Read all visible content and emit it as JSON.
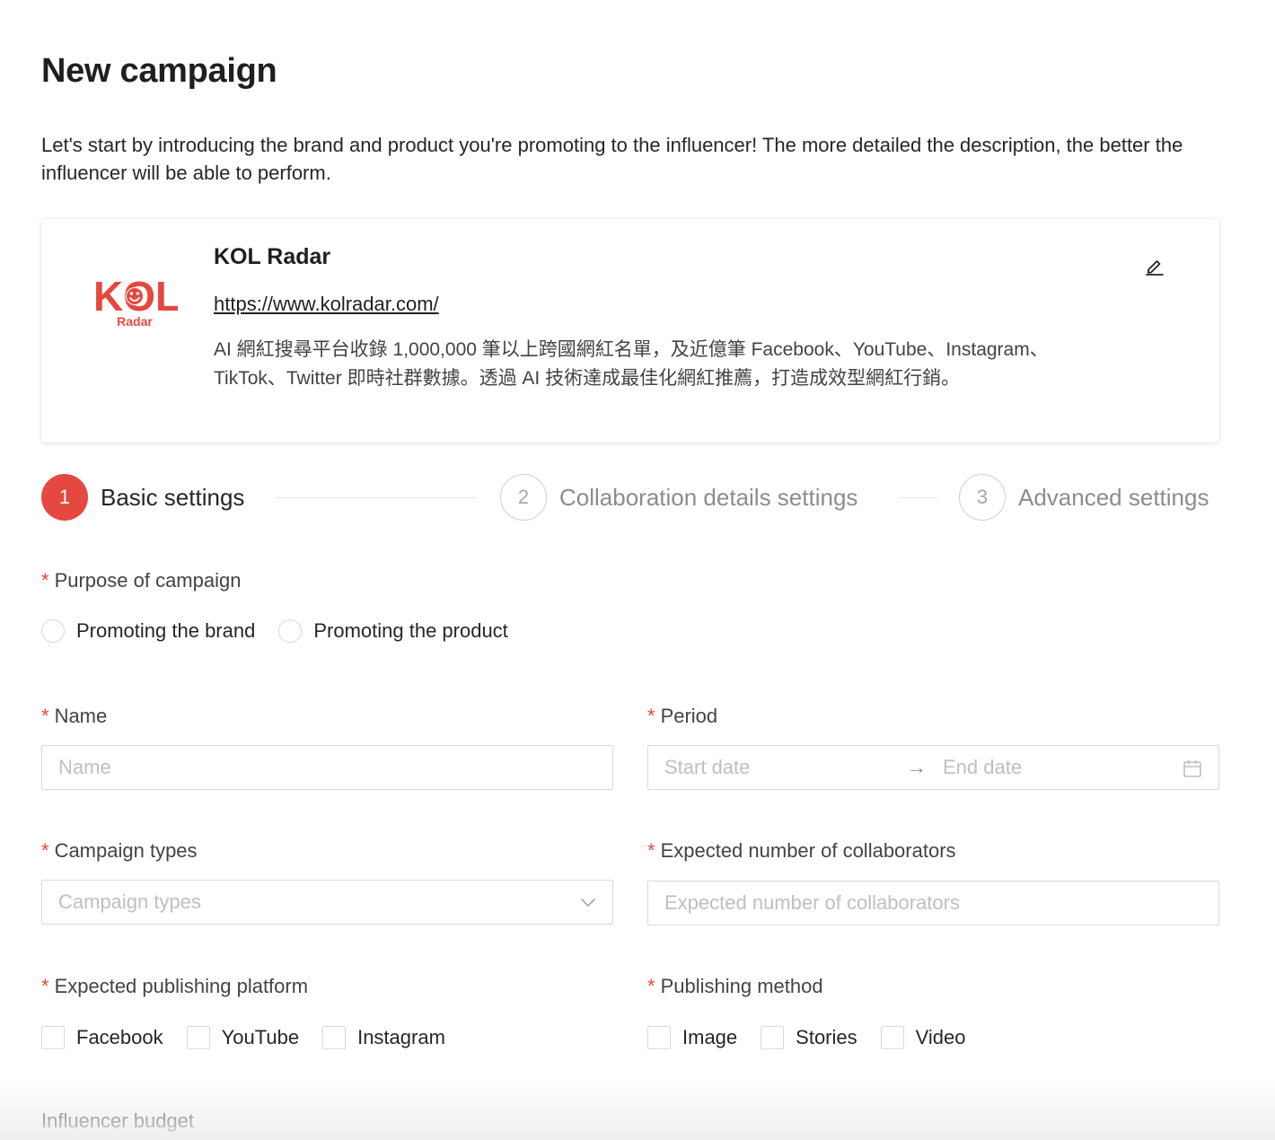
{
  "page": {
    "title": "New campaign",
    "intro": "Let's start by introducing the brand and product you're promoting to the influencer! The more detailed the description, the better the influencer will be able to perform."
  },
  "brand": {
    "logo_text": "KOL",
    "logo_sub": "Radar",
    "name": "KOL Radar",
    "url": "https://www.kolradar.com/",
    "description": "AI 網紅搜尋平台收錄 1,000,000 筆以上跨國網紅名單，及近億筆 Facebook、YouTube、Instagram、TikTok、Twitter 即時社群數據。透過 AI 技術達成最佳化網紅推薦，打造成效型網紅行銷。",
    "edit_icon": "pencil-icon"
  },
  "steps": [
    {
      "number": "1",
      "label": "Basic settings",
      "state": "active"
    },
    {
      "number": "2",
      "label": "Collaboration details settings",
      "state": "idle"
    },
    {
      "number": "3",
      "label": "Advanced settings",
      "state": "idle"
    }
  ],
  "form": {
    "required_mark": "*",
    "purpose": {
      "label": "Purpose of campaign",
      "options": [
        "Promoting the brand",
        "Promoting the product"
      ]
    },
    "name": {
      "label": "Name",
      "placeholder": "Name"
    },
    "period": {
      "label": "Period",
      "start_placeholder": "Start date",
      "end_placeholder": "End date",
      "separator": "→"
    },
    "campaign_types": {
      "label": "Campaign types",
      "placeholder": "Campaign types"
    },
    "collaborators": {
      "label": "Expected number of collaborators",
      "placeholder": "Expected number of collaborators"
    },
    "platform": {
      "label": "Expected publishing platform",
      "options": [
        "Facebook",
        "YouTube",
        "Instagram"
      ]
    },
    "method": {
      "label": "Publishing method",
      "options": [
        "Image",
        "Stories",
        "Video"
      ]
    },
    "budget": {
      "label": "Influencer budget"
    }
  },
  "colors": {
    "accent": "#e5483f",
    "border": "#d9d9d9",
    "placeholder": "#bfbfbf"
  }
}
